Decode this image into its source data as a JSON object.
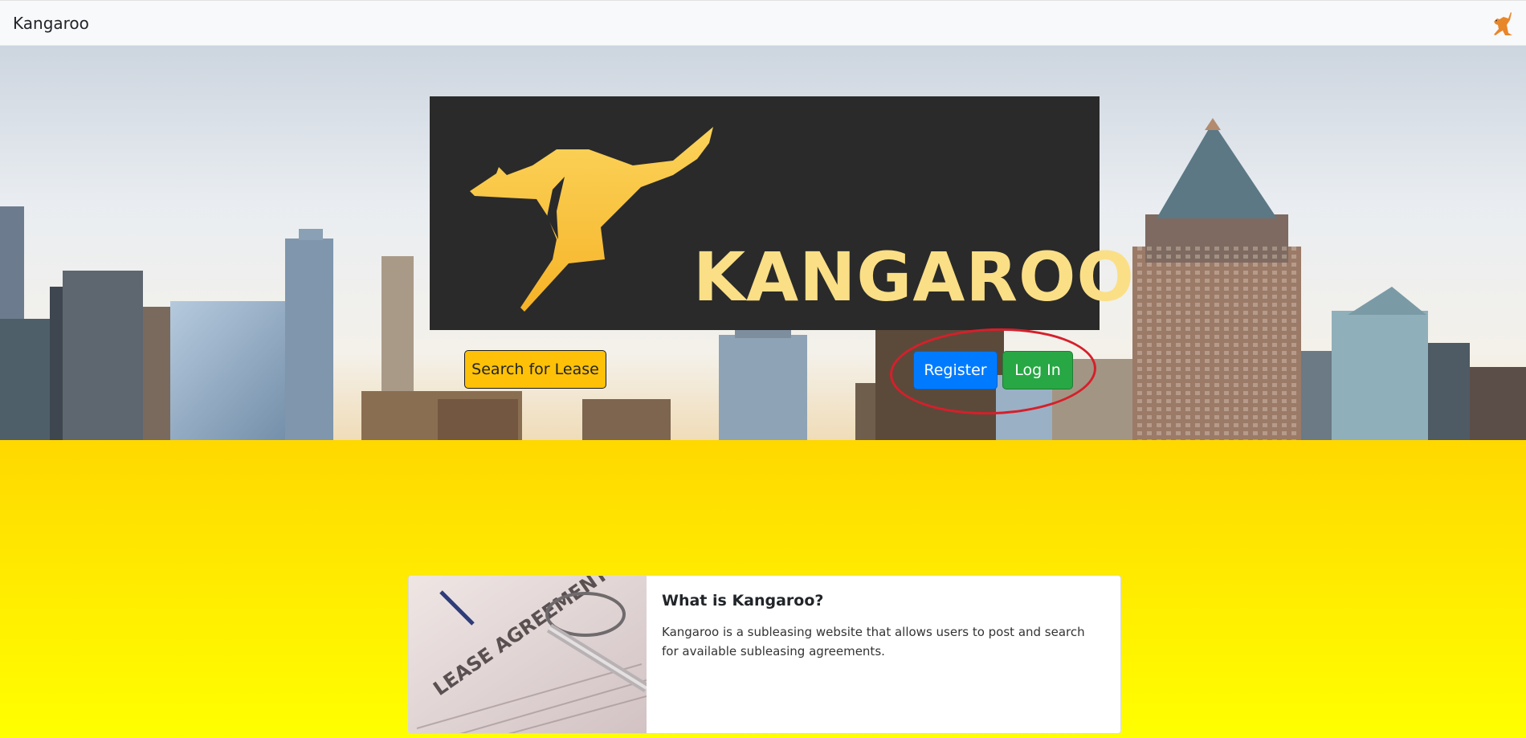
{
  "navbar": {
    "brand": "Kangaroo",
    "icon": "kangaroo-icon"
  },
  "hero": {
    "logo_text": "KANGAROO",
    "search_button": "Search for Lease",
    "register_button": "Register",
    "login_button": "Log In"
  },
  "card": {
    "image_text": "LEASE AGREEMENT",
    "title": "What is Kangaroo?",
    "text": "Kangaroo is a subleasing website that allows users to post and search for available subleasing agreements."
  },
  "colors": {
    "nav_bg": "#f8f9fa",
    "logo_bg": "#2a2a2a",
    "logo_accent": "#fbdf86",
    "search_button": "#ffc107",
    "register_button": "#007bff",
    "login_button": "#28a745",
    "annotation": "#d61f2b",
    "yellow_top": "#ffd800",
    "yellow_bottom": "#ffff00"
  }
}
